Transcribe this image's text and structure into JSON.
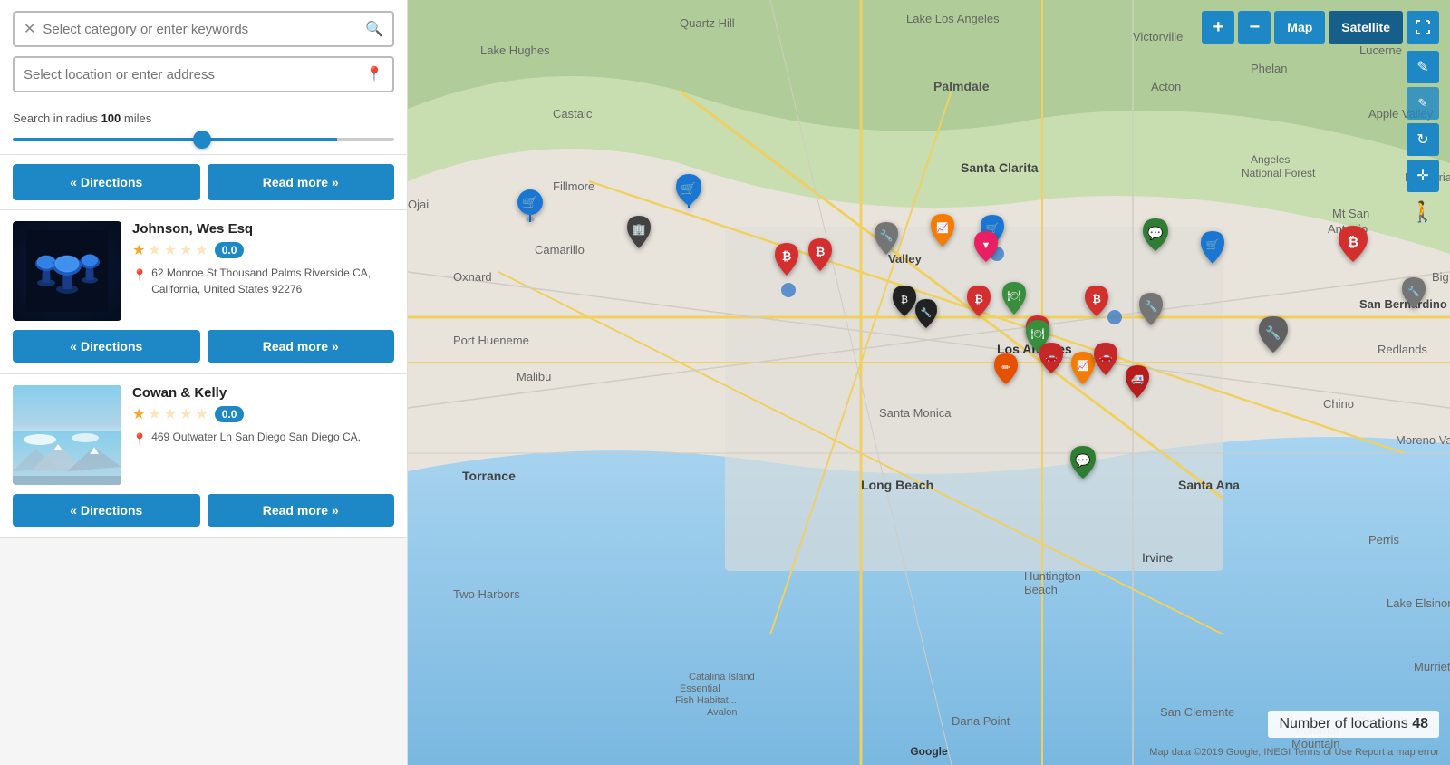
{
  "search": {
    "category_placeholder": "Select category or enter keywords",
    "location_placeholder": "Select location or enter address",
    "radius_label": "Search in radius",
    "radius_value": "100",
    "radius_unit": "miles"
  },
  "buttons": {
    "directions_label": "« Directions",
    "read_more_label": "Read more »"
  },
  "results": [
    {
      "id": 1,
      "name": "Johnson, Wes Esq",
      "rating": 0.0,
      "address": "62 Monroe St Thousand Palms Riverside CA, California, United States 92276",
      "image_type": "mushroom"
    },
    {
      "id": 2,
      "name": "Cowan & Kelly",
      "rating": 0.0,
      "address": "469 Outwater Ln San Diego San Diego CA,",
      "image_type": "mountain"
    }
  ],
  "map": {
    "zoom_in": "+",
    "zoom_out": "−",
    "map_label": "Map",
    "satellite_label": "Satellite",
    "locations_count_label": "Number of locations",
    "locations_count": "48",
    "google_label": "Google",
    "map_footer": "Map data ©2019 Google, INEGI  Terms of Use  Report a map error",
    "edit_icon": "✎",
    "refresh_icon": "↻",
    "move_icon": "✛",
    "person_icon": "🚶"
  }
}
